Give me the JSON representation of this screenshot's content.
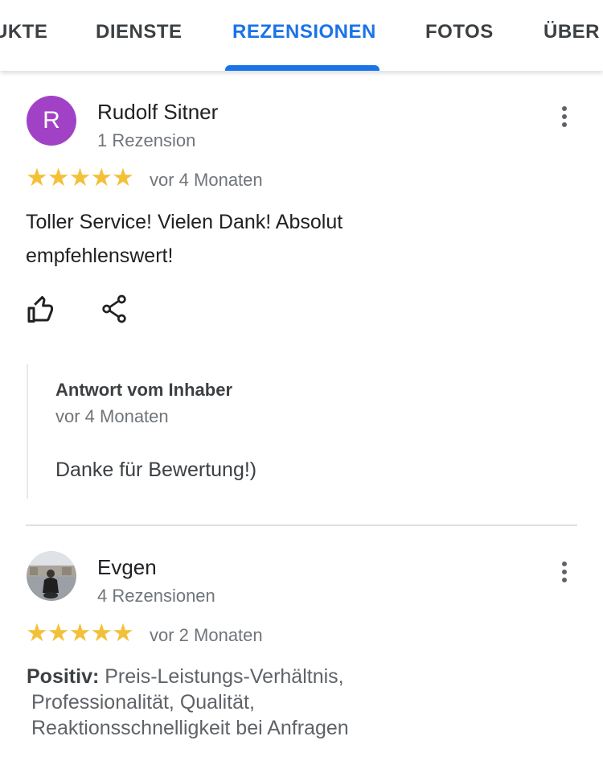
{
  "tabs": [
    {
      "label": "UKTE",
      "active": false
    },
    {
      "label": "DIENSTE",
      "active": false
    },
    {
      "label": "REZENSIONEN",
      "active": true
    },
    {
      "label": "FOTOS",
      "active": false
    },
    {
      "label": "ÜBER",
      "active": false
    }
  ],
  "colors": {
    "accent": "#1a73e8",
    "star": "#f2c139",
    "avatar_r": "#a142c6"
  },
  "reviews": [
    {
      "avatar_letter": "R",
      "author": "Rudolf Sitner",
      "review_count": "1 Rezension",
      "stars": "★★★★★",
      "rating": 5,
      "time": "vor 4 Monaten",
      "text": "Toller Service! Vielen Dank! Absolut empfehlenswert!",
      "icons": {
        "like": "thumbs-up-icon",
        "share": "share-icon",
        "menu": "more-vert-icon"
      },
      "owner_reply": {
        "title": "Antwort vom Inhaber",
        "time": "vor 4 Monaten",
        "text": "Danke für Bewertung!)"
      }
    },
    {
      "author": "Evgen",
      "review_count": "4 Rezensionen",
      "stars": "★★★★★",
      "rating": 5,
      "time": "vor 2 Monaten",
      "positive_label": "Positiv:",
      "positive_line1": "Preis-Leistungs-Verhältnis,",
      "positive_line2": "Professionalität, Qualität,",
      "positive_line3": "Reaktionsschnelligkeit bei Anfragen"
    }
  ]
}
